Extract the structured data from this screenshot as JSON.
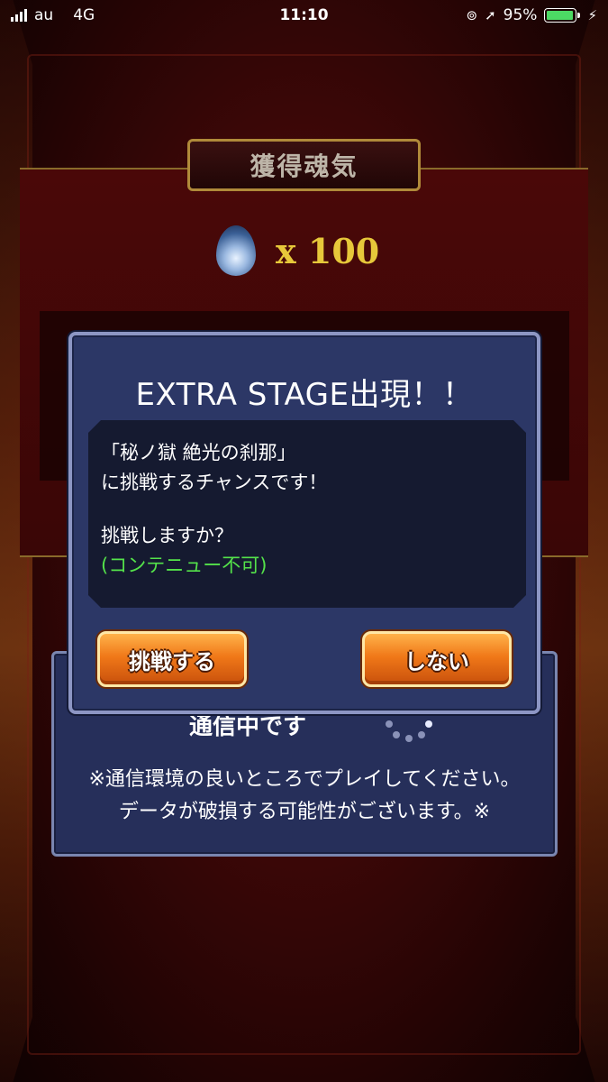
{
  "status_bar": {
    "carrier": "au",
    "network": "4G",
    "time": "11:10",
    "battery_percent": "95%",
    "battery_level": 0.95,
    "battery_color": "#4cd964"
  },
  "result": {
    "header": "獲得魂気",
    "soul_icon": "blue-flame-icon",
    "soul_amount": "x 100"
  },
  "comm_panel": {
    "status_text": "通信中です",
    "note_line1": "※通信環境の良いところでプレイしてください。",
    "note_line2": "データが破損する可能性がございます。※"
  },
  "modal": {
    "title": "EXTRA STAGE出現！！",
    "line1": "「秘ノ獄 絶光の刹那」",
    "line2": "に挑戦するチャンスです！",
    "question": "挑戦しますか？",
    "note": "(コンテニュー不可)",
    "note_color": "#54e24a",
    "accept_label": "挑戦する",
    "decline_label": "しない"
  }
}
